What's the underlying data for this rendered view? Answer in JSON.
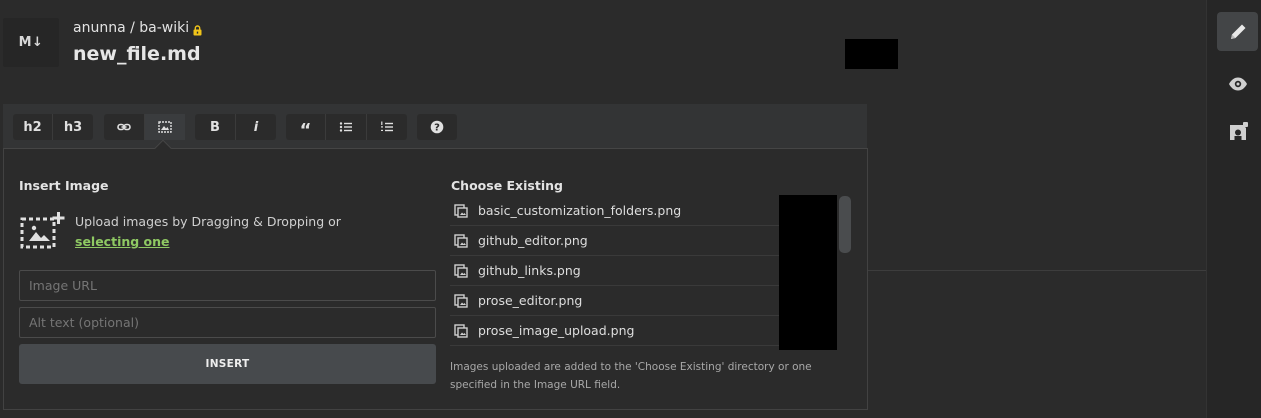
{
  "header": {
    "badge": "M↓",
    "breadcrumb": "anunna / ba-wiki",
    "filename": "new_file.md"
  },
  "toolbar": {
    "h2": "h2",
    "h3": "h3",
    "bold": "B",
    "italic": "i",
    "quote": "“",
    "help": "?"
  },
  "insert_panel": {
    "insert_title": "Insert Image",
    "upload_text": "Upload images by Dragging & Dropping or",
    "upload_link": "selecting one",
    "url_placeholder": "Image URL",
    "alt_placeholder": "Alt text (optional)",
    "insert_button": "INSERT",
    "existing_title": "Choose Existing",
    "files": [
      "basic_customization_folders.png",
      "github_editor.png",
      "github_links.png",
      "prose_editor.png",
      "prose_image_upload.png"
    ],
    "hint": "Images uploaded are added to the 'Choose Existing' directory or one specified in the Image URL field."
  },
  "colors": {
    "accent_link": "#8fc963",
    "lock": "#f0c419",
    "background": "#2b2b2b"
  },
  "icons": {
    "rail": [
      "pencil-icon",
      "eye-icon",
      "settings-file-icon"
    ]
  }
}
